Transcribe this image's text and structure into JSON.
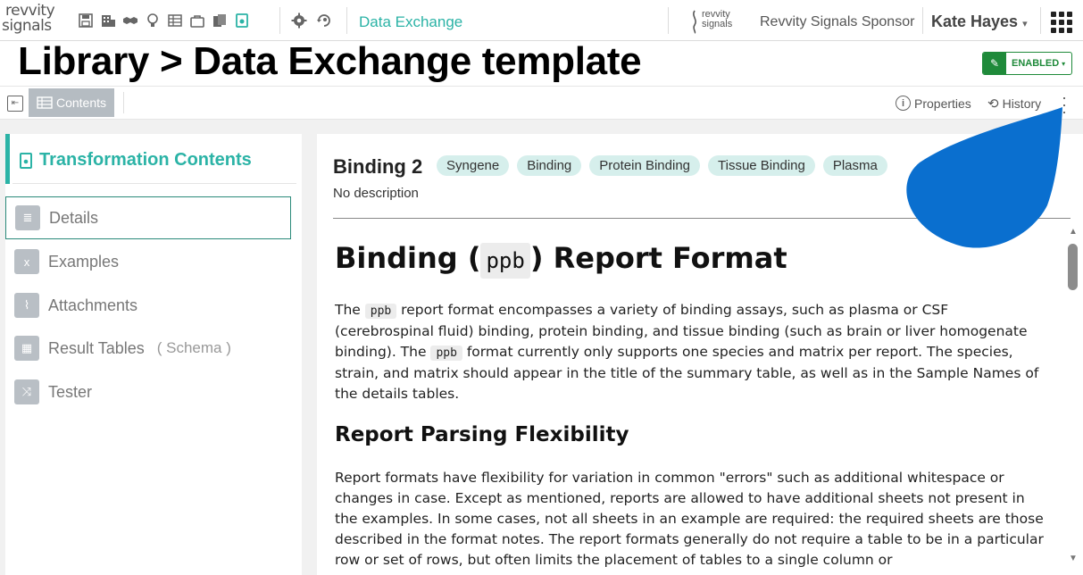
{
  "brand": {
    "line1": "revvity",
    "line2": "signals"
  },
  "app": {
    "name": "Data Exchange"
  },
  "sponsor": {
    "logo_line1": "revvity",
    "logo_line2": "signals",
    "name": "Revvity Signals Sponsor"
  },
  "user": {
    "name": "Kate Hayes",
    "caret": "▾"
  },
  "page": {
    "title": "Library > Data Exchange template"
  },
  "status": {
    "label": "ENABLED",
    "caret": "▾"
  },
  "toolbar": {
    "contents_label": "Contents",
    "properties_label": "Properties",
    "history_label": "History"
  },
  "nav": {
    "header": "Transformation Contents",
    "items": [
      {
        "label": "Details"
      },
      {
        "label": "Examples"
      },
      {
        "label": "Attachments"
      },
      {
        "label": "Result Tables",
        "sub": "( Schema )"
      },
      {
        "label": "Tester"
      }
    ]
  },
  "template": {
    "name": "Binding 2",
    "tags": [
      "Syngene",
      "Binding",
      "Protein Binding",
      "Tissue Binding",
      "Plasma"
    ],
    "description": "No description"
  },
  "doc": {
    "h1_pre": "Binding (",
    "h1_code": "ppb",
    "h1_post": ") Report Format",
    "p1_a": "The ",
    "p1_code1": "ppb",
    "p1_b": " report format encompasses a variety of binding assays, such as plasma or CSF (cerebrospinal fluid) binding, protein binding, and tissue binding (such as brain or liver homogenate binding). The ",
    "p1_code2": "ppb",
    "p1_c": " format currently only supports one species and matrix per report. The species, strain, and matrix should appear in the title of the summary table, as well as in the Sample Names of the details tables.",
    "h2": "Report Parsing Flexibility",
    "p2": "Report formats have flexibility for variation in common \"errors\" such as additional whitespace or changes in case. Except as mentioned, reports are allowed to have additional sheets not present in the examples. In some cases, not all sheets in an example are required: the required sheets are those described in the format notes. The report formats generally do not require a table to be in a particular row or set of rows, but often limits the placement of tables to a single column or"
  },
  "colors": {
    "accent": "#2bb3a6",
    "enabled": "#1f8a3a",
    "blob": "#0a6fcf"
  }
}
